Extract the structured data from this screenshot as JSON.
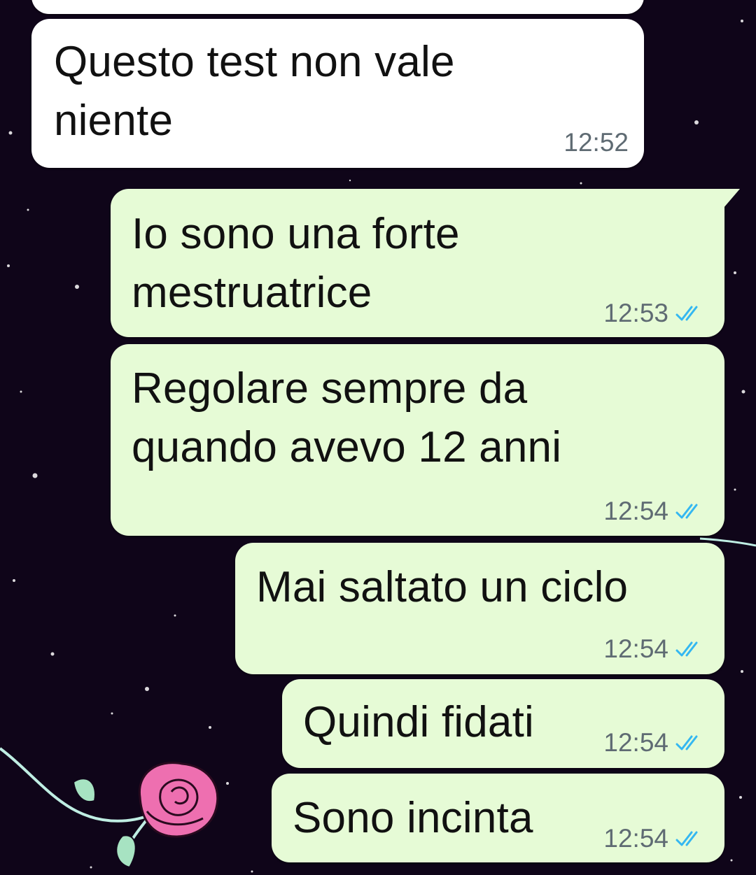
{
  "conversation": {
    "messages": [
      {
        "direction": "incoming",
        "lines": [
          "Questo test non vale",
          "niente"
        ],
        "time": "12:52",
        "status": ""
      },
      {
        "direction": "outgoing",
        "lines": [
          "Io sono una forte",
          "mestruatrice"
        ],
        "time": "12:53",
        "status": "read"
      },
      {
        "direction": "outgoing",
        "lines": [
          "Regolare sempre da",
          "quando avevo 12 anni"
        ],
        "time": "12:54",
        "status": "read"
      },
      {
        "direction": "outgoing",
        "lines": [
          "Mai saltato un ciclo"
        ],
        "time": "12:54",
        "status": "read"
      },
      {
        "direction": "outgoing",
        "lines": [
          "Quindi fidati"
        ],
        "time": "12:54",
        "status": "read"
      },
      {
        "direction": "outgoing",
        "lines": [
          "Sono incinta"
        ],
        "time": "12:54",
        "status": "read"
      }
    ]
  },
  "theme": {
    "background": "#0f0519",
    "incoming_bubble": "#ffffff",
    "outgoing_bubble": "#e6fbd6",
    "timestamp_color": "#5f6b73",
    "read_tick_color": "#34b7f1"
  },
  "icons": {
    "read_receipt": "double-check-icon",
    "wallpaper": "rose-starry-night-wallpaper"
  }
}
